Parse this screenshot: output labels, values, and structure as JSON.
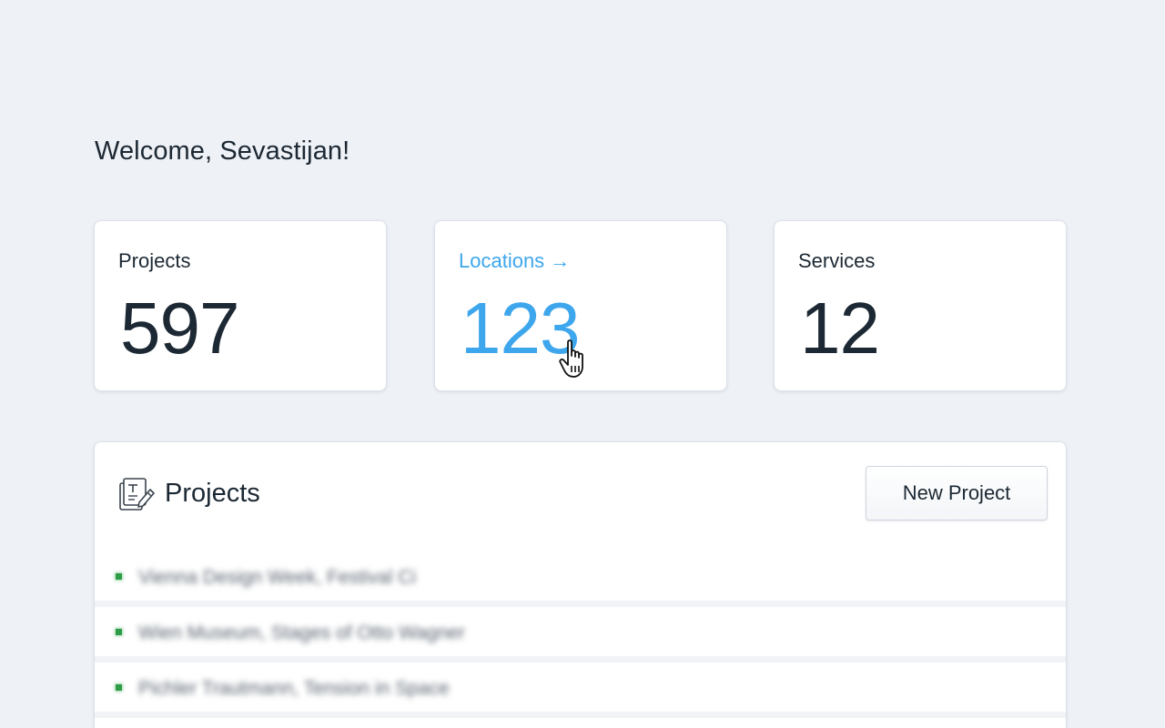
{
  "welcome": "Welcome, Sevastijan!",
  "stats": [
    {
      "label": "Projects",
      "value": "597"
    },
    {
      "label": "Locations",
      "arrow": "→",
      "value": "123"
    },
    {
      "label": "Services",
      "value": "12"
    }
  ],
  "colors": {
    "background": "#eef1f6",
    "link": "#3ea6ec",
    "text": "#1c2833",
    "status_active": "#2e9d47"
  },
  "projects_panel": {
    "icon": "document-edit-icon",
    "title": "Projects",
    "new_button": "New Project",
    "items": [
      {
        "name": "Vienna Design Week, Festival Ci"
      },
      {
        "name": "Wien Museum, Stages of Otto Wagner"
      },
      {
        "name": "Pichler Trautmann, Tension in Space"
      }
    ]
  }
}
